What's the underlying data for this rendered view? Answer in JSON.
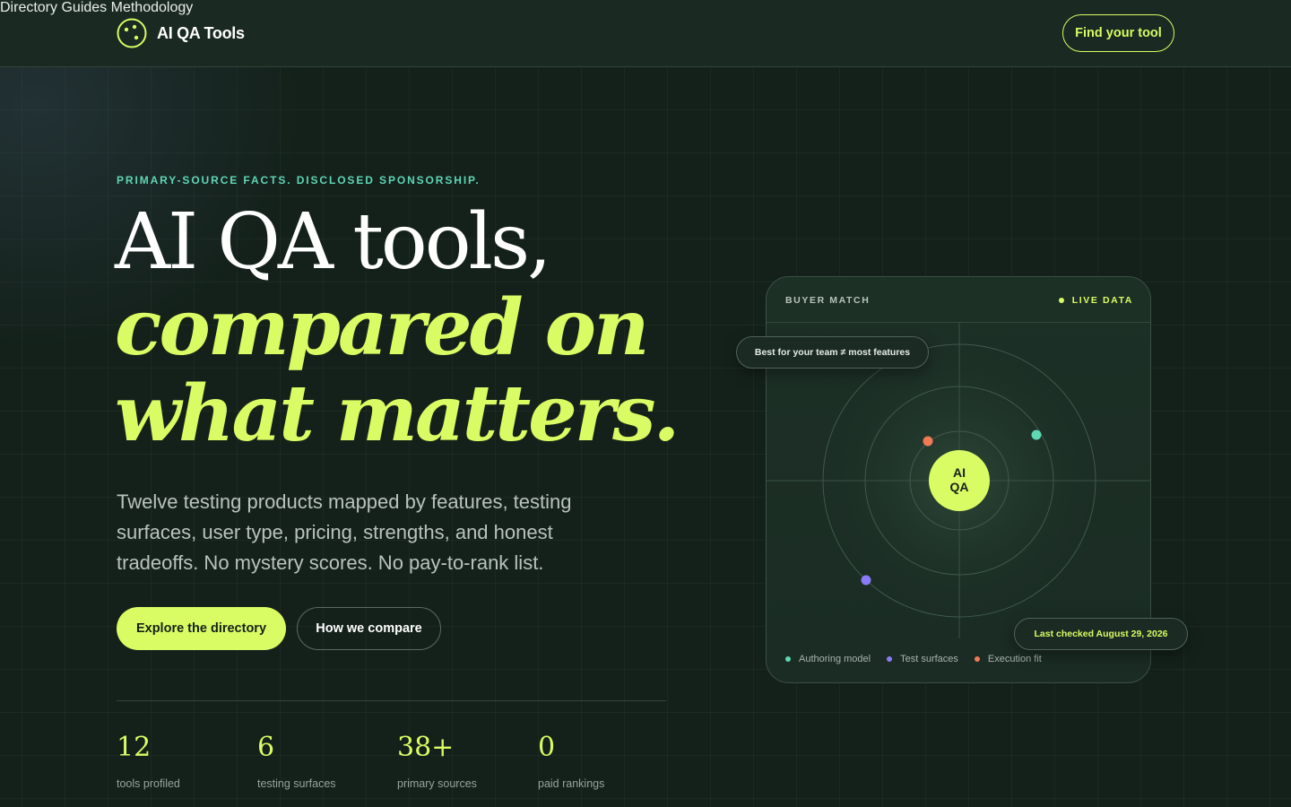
{
  "brand": {
    "name": "AI QA Tools"
  },
  "nav": {
    "items": [
      "Directory",
      "Guides",
      "Methodology"
    ],
    "cta": "Find your tool"
  },
  "hero": {
    "eyebrow": "PRIMARY-SOURCE FACTS. DISCLOSED SPONSORSHIP.",
    "headline": [
      "AI QA tools,",
      "compared on",
      "what matters."
    ],
    "lede": "Twelve testing products mapped by features, testing surfaces, user type, pricing, strengths, and honest tradeoffs. No mystery scores. No pay-to-rank list.",
    "primary_button": "Explore the directory",
    "secondary_button": "How we compare"
  },
  "stats": [
    {
      "value": "12",
      "label": "tools profiled"
    },
    {
      "value": "6",
      "label": "testing surfaces"
    },
    {
      "value": "38+",
      "label": "primary sources"
    },
    {
      "value": "0",
      "label": "paid rankings"
    }
  ],
  "card": {
    "title": "BUYER MATCH",
    "live_label": "LIVE DATA",
    "center_label": [
      "AI",
      "QA"
    ],
    "top_chip": "Best for your team ≠ most features",
    "bottom_chip": "Last checked August 29, 2026",
    "legend": [
      {
        "label": "Authoring model",
        "color": "#5fd6b4"
      },
      {
        "label": "Test surfaces",
        "color": "#8b7cf6"
      },
      {
        "label": "Execution fit",
        "color": "#f07a55"
      }
    ]
  },
  "colors": {
    "accent": "#d9fb63",
    "teal": "#5fd6b4",
    "background": "#14211b"
  }
}
